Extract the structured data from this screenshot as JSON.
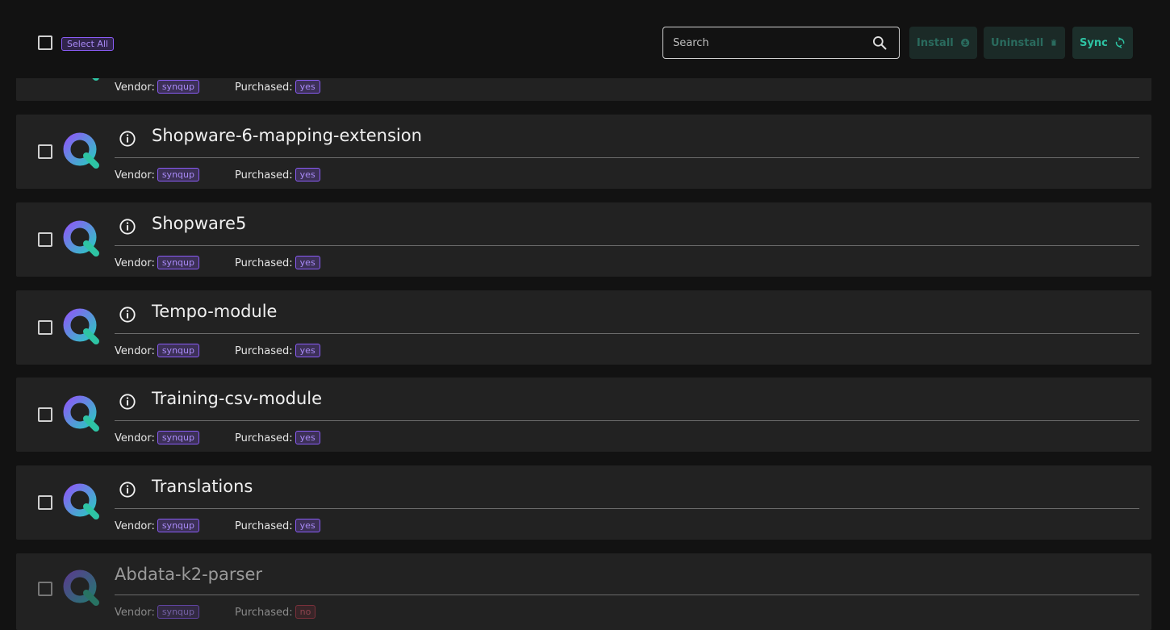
{
  "toolbar": {
    "select_all_label": "Select All",
    "search_placeholder": "Search",
    "install_label": "Install",
    "uninstall_label": "Uninstall",
    "sync_label": "Sync"
  },
  "labels": {
    "vendor": "Vendor:",
    "purchased": "Purchased:"
  },
  "modules": [
    {
      "name": "",
      "vendor": "synqup",
      "purchased": "yes"
    },
    {
      "name": "Shopware-6-mapping-extension",
      "vendor": "synqup",
      "purchased": "yes"
    },
    {
      "name": "Shopware5",
      "vendor": "synqup",
      "purchased": "yes"
    },
    {
      "name": "Tempo-module",
      "vendor": "synqup",
      "purchased": "yes"
    },
    {
      "name": "Training-csv-module",
      "vendor": "synqup",
      "purchased": "yes"
    },
    {
      "name": "Translations",
      "vendor": "synqup",
      "purchased": "yes"
    },
    {
      "name": "Abdata-k2-parser",
      "vendor": "synqup",
      "purchased": "no"
    }
  ],
  "colors": {
    "accent_purple": "#8a5cf6",
    "accent_teal": "#2ec4a4",
    "danger": "#b53a4a",
    "card_bg": "#222222",
    "page_bg": "#121212"
  },
  "icons": {
    "search": "search-icon",
    "install": "download-circle-icon",
    "uninstall": "trash-icon",
    "sync": "sync-icon",
    "info": "info-icon",
    "logo": "synqup-logo-icon"
  }
}
